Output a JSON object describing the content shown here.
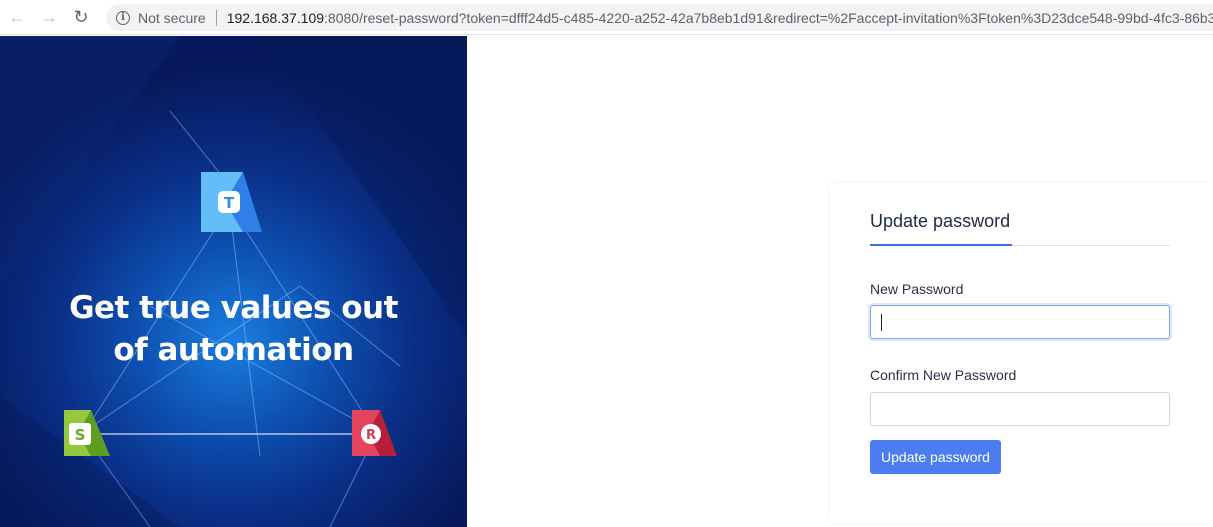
{
  "browser": {
    "security_label": "Not secure",
    "url_host": "192.168.37.109",
    "url_rest": ":8080/reset-password?token=dfff24d5-c485-4220-a252-42a7b8eb1d91&redirect=%2Faccept-invitation%3Ftoken%3D23dce548-99bd-4fc3-86b3-",
    "back_icon": "arrow-left-icon",
    "forward_icon": "arrow-right-icon",
    "reload_icon": "reload-icon",
    "info_icon": "info-icon"
  },
  "banner": {
    "headline_line1": "Get true values out",
    "headline_line2": "of automation",
    "logos": [
      {
        "letter": "T",
        "color": "#5bb8f5"
      },
      {
        "letter": "S",
        "color": "#8bbf3c"
      },
      {
        "letter": "R",
        "color": "#e0405a"
      }
    ]
  },
  "form": {
    "tab_label": "Update password",
    "new_password_label": "New Password",
    "new_password_value": "",
    "confirm_password_label": "Confirm New Password",
    "confirm_password_value": "",
    "submit_label": "Update password"
  },
  "colors": {
    "accent": "#4c7df0",
    "tab_underline": "#3d6fe0"
  }
}
